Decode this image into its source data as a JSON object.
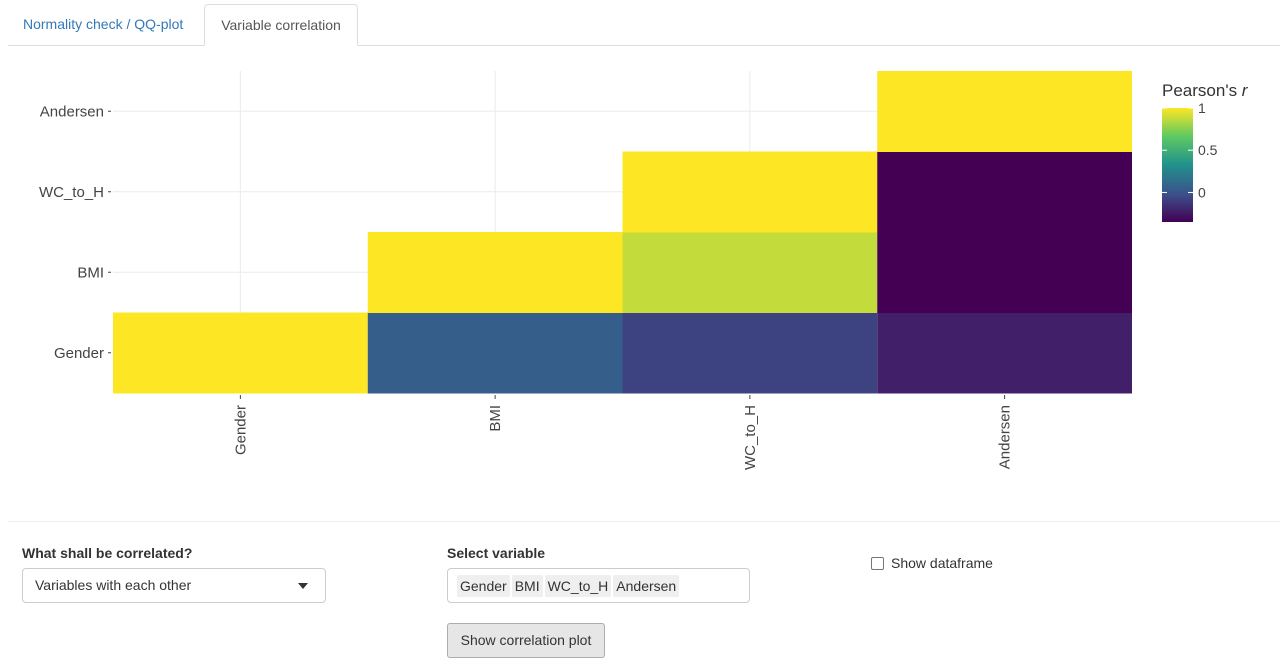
{
  "tabs": [
    {
      "label": "Normality check / QQ-plot",
      "active": false
    },
    {
      "label": "Variable correlation",
      "active": true
    }
  ],
  "chart_data": {
    "type": "heatmap",
    "x_categories": [
      "Gender",
      "BMI",
      "WC_to_H",
      "Andersen"
    ],
    "y_categories": [
      "Gender",
      "BMI",
      "WC_to_H",
      "Andersen"
    ],
    "cells": [
      {
        "x": "Gender",
        "y": "Gender",
        "r": 1.0
      },
      {
        "x": "BMI",
        "y": "Gender",
        "r": 0.05
      },
      {
        "x": "WC_to_H",
        "y": "Gender",
        "r": -0.08
      },
      {
        "x": "Andersen",
        "y": "Gender",
        "r": -0.22
      },
      {
        "x": "BMI",
        "y": "BMI",
        "r": 1.0
      },
      {
        "x": "WC_to_H",
        "y": "BMI",
        "r": 0.88
      },
      {
        "x": "Andersen",
        "y": "BMI",
        "r": -0.35
      },
      {
        "x": "WC_to_H",
        "y": "WC_to_H",
        "r": 1.0
      },
      {
        "x": "Andersen",
        "y": "WC_to_H",
        "r": -0.35
      },
      {
        "x": "Andersen",
        "y": "Andersen",
        "r": 1.0
      }
    ],
    "legend": {
      "title_prefix": "Pearson's ",
      "title_italic": "r",
      "ticks": [
        {
          "value": 1,
          "label": "1"
        },
        {
          "value": 0.5,
          "label": "0.5"
        },
        {
          "value": 0,
          "label": "0"
        }
      ],
      "range": [
        -0.35,
        1.0
      ],
      "placement": "right",
      "colorscale": [
        "#440154",
        "#3b528b",
        "#21918c",
        "#5ec962",
        "#fde725"
      ]
    },
    "grid": true
  },
  "controls": {
    "correlate_label": "What shall be correlated?",
    "correlate_value": "Variables with each other",
    "variable_label": "Select variable",
    "selected_variables": [
      "Gender",
      "BMI",
      "WC_to_H",
      "Andersen"
    ],
    "show_dataframe_label": "Show dataframe",
    "show_dataframe_checked": false,
    "plot_button_label": "Show correlation plot"
  }
}
